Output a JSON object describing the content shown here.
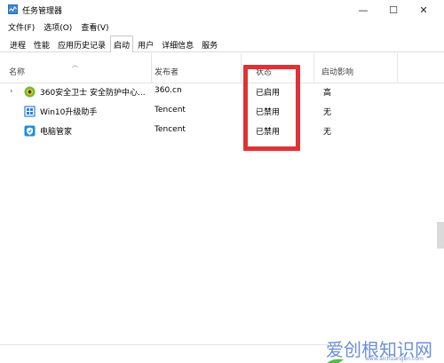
{
  "window": {
    "title": "任务管理器",
    "minimize": "—",
    "maximize": "☐",
    "close": "✕"
  },
  "menu": [
    "文件(F)",
    "选项(O)",
    "查看(V)"
  ],
  "tabs": [
    {
      "label": "进程",
      "active": false
    },
    {
      "label": "性能",
      "active": false
    },
    {
      "label": "应用历史记录",
      "active": false
    },
    {
      "label": "启动",
      "active": true
    },
    {
      "label": "用户",
      "active": false
    },
    {
      "label": "详细信息",
      "active": false
    },
    {
      "label": "服务",
      "active": false
    }
  ],
  "columns": {
    "name": "名称",
    "publisher": "发布者",
    "status": "状态",
    "impact": "启动影响"
  },
  "rows": [
    {
      "expand": "›",
      "icon": "360-icon",
      "name": "360安全卫士 安全防护中心...",
      "publisher": "360.cn",
      "status": "已启用",
      "impact": "高"
    },
    {
      "expand": "",
      "icon": "win10-upgrade-icon",
      "name": "Win10升级助手",
      "publisher": "Tencent",
      "status": "已禁用",
      "impact": "无"
    },
    {
      "expand": "",
      "icon": "pc-manager-icon",
      "name": "电脑管家",
      "publisher": "Tencent",
      "status": "已禁用",
      "impact": "无"
    }
  ],
  "watermark": {
    "text": "爱创根知识网",
    "url": "www.aichuangen.com"
  },
  "colors": {
    "highlight": "#e03236",
    "watermark": "#6b8fd9"
  }
}
